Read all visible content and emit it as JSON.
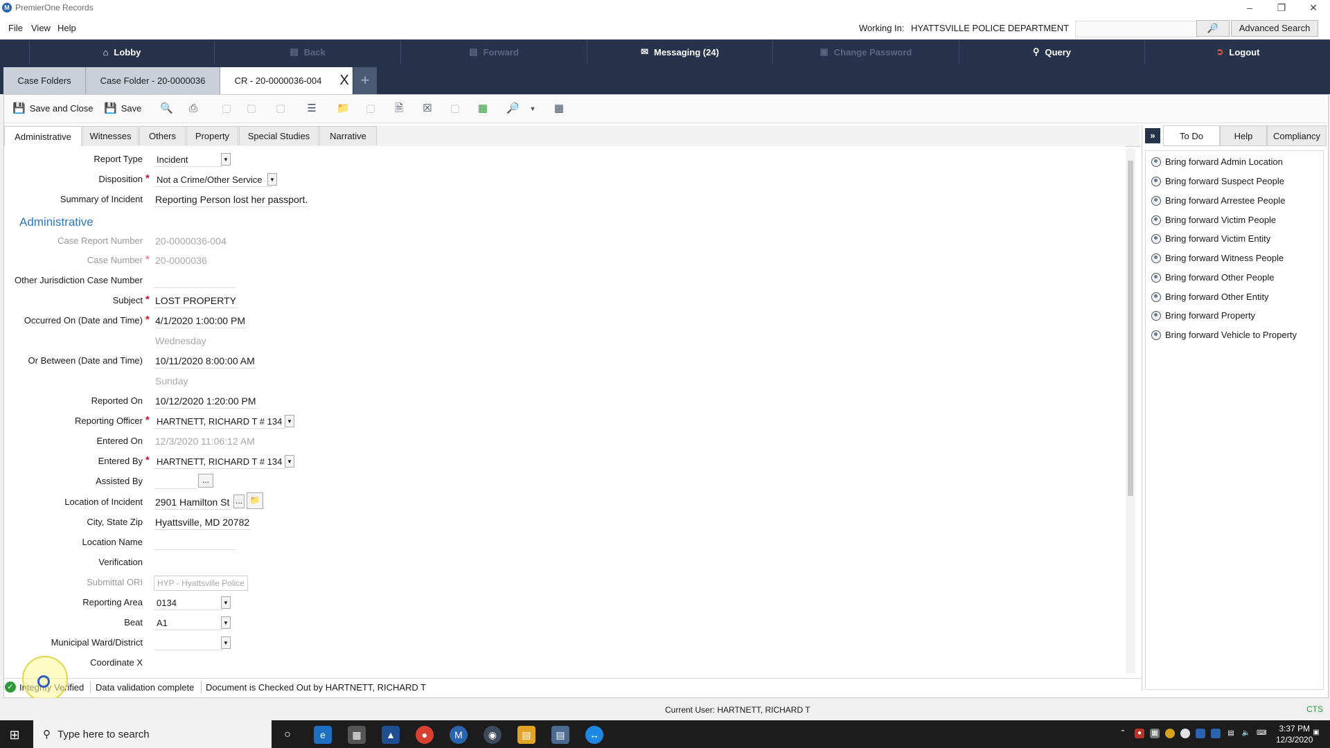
{
  "app": {
    "title": "PremierOne Records",
    "logo": "M"
  },
  "window_controls": {
    "minimize": "–",
    "maximize": "❐",
    "close": "✕"
  },
  "menu": {
    "items": [
      "File",
      "View",
      "Help"
    ],
    "working_in_label": "Working In:",
    "working_in_value": "HYATTSVILLE POLICE DEPARTMENT",
    "search_placeholder": "",
    "advanced_search": "Advanced Search"
  },
  "nav": {
    "lobby": "Lobby",
    "back": "Back",
    "forward": "Forward",
    "messaging": "Messaging (24)",
    "change_password": "Change Password",
    "query": "Query",
    "logout": "Logout"
  },
  "case_tabs": {
    "tab1": "Case Folders",
    "tab2": "Case Folder - 20-0000036",
    "tab3": "CR - 20-0000036-004",
    "close": "X",
    "add": "+"
  },
  "toolbar": {
    "save_close": "Save and Close",
    "save": "Save"
  },
  "section_tabs": [
    "Administrative",
    "Witnesses",
    "Others",
    "Property",
    "Special Studies",
    "Narrative"
  ],
  "form": {
    "report_type_label": "Report Type",
    "report_type_value": "Incident",
    "disposition_label": "Disposition",
    "disposition_value": "Not a Crime/Other Service",
    "summary_label": "Summary of Incident",
    "summary_value": "Reporting Person lost her passport.",
    "section_heading": "Administrative",
    "case_report_number_label": "Case Report Number",
    "case_report_number_value": "20-0000036-004",
    "case_number_label": "Case Number",
    "case_number_value": "20-0000036",
    "other_jurisdiction_label": "Other Jurisdiction Case Number",
    "other_jurisdiction_value": "",
    "subject_label": "Subject",
    "subject_value": "LOST PROPERTY",
    "occurred_on_label": "Occurred On (Date and Time)",
    "occurred_on_value": "4/1/2020 1:00:00 PM",
    "occurred_on_day": "Wednesday",
    "or_between_label": "Or Between (Date and Time)",
    "or_between_value": "10/11/2020 8:00:00 AM",
    "or_between_day": "Sunday",
    "reported_on_label": "Reported On",
    "reported_on_value": "10/12/2020 1:20:00 PM",
    "reporting_officer_label": "Reporting Officer",
    "reporting_officer_value": "HARTNETT, RICHARD T # 134",
    "entered_on_label": "Entered On",
    "entered_on_value": "12/3/2020 11:06:12 AM",
    "entered_by_label": "Entered By",
    "entered_by_value": "HARTNETT, RICHARD T # 134",
    "assisted_by_label": "Assisted By",
    "ellipsis": "...",
    "location_label": "Location of Incident",
    "location_value": "2901 Hamilton St",
    "city_label": "City, State Zip",
    "city_value": "Hyattsville, MD 20782",
    "location_name_label": "Location Name",
    "verification_label": "Verification",
    "submittal_ori_label": "Submittal ORI",
    "submittal_ori_value": "HYP - Hyattsville Police",
    "reporting_area_label": "Reporting Area",
    "reporting_area_value": "0134",
    "beat_label": "Beat",
    "beat_value": "A1",
    "ward_label": "Municipal Ward/District",
    "ward_value": "",
    "coord_x_label": "Coordinate X",
    "required_mark": "*"
  },
  "right_panel": {
    "collapse": "»",
    "tabs": [
      "To Do",
      "Help",
      "Compliancy"
    ],
    "todo": [
      "Bring forward Admin Location",
      "Bring forward Suspect People",
      "Bring forward Arrestee People",
      "Bring forward Victim People",
      "Bring forward Victim Entity",
      "Bring forward Witness People",
      "Bring forward Other People",
      "Bring forward Other Entity",
      "Bring forward Property",
      "Bring forward Vehicle to Property"
    ]
  },
  "status": {
    "integrity": "Integrity Verified",
    "validation": "Data validation complete",
    "checkout": "Document is Checked Out by HARTNETT, RICHARD T"
  },
  "footer": {
    "current_user": "Current User: HARTNETT, RICHARD T",
    "cts": "CTS"
  },
  "taskbar": {
    "search_placeholder": "Type here to search",
    "time": "3:37 PM",
    "date": "12/3/2020"
  },
  "colors": {
    "nav_bg": "#26334a",
    "accent_blue": "#2e77b8",
    "required_red": "#c8102e",
    "ok_green": "#2e9a3a"
  }
}
